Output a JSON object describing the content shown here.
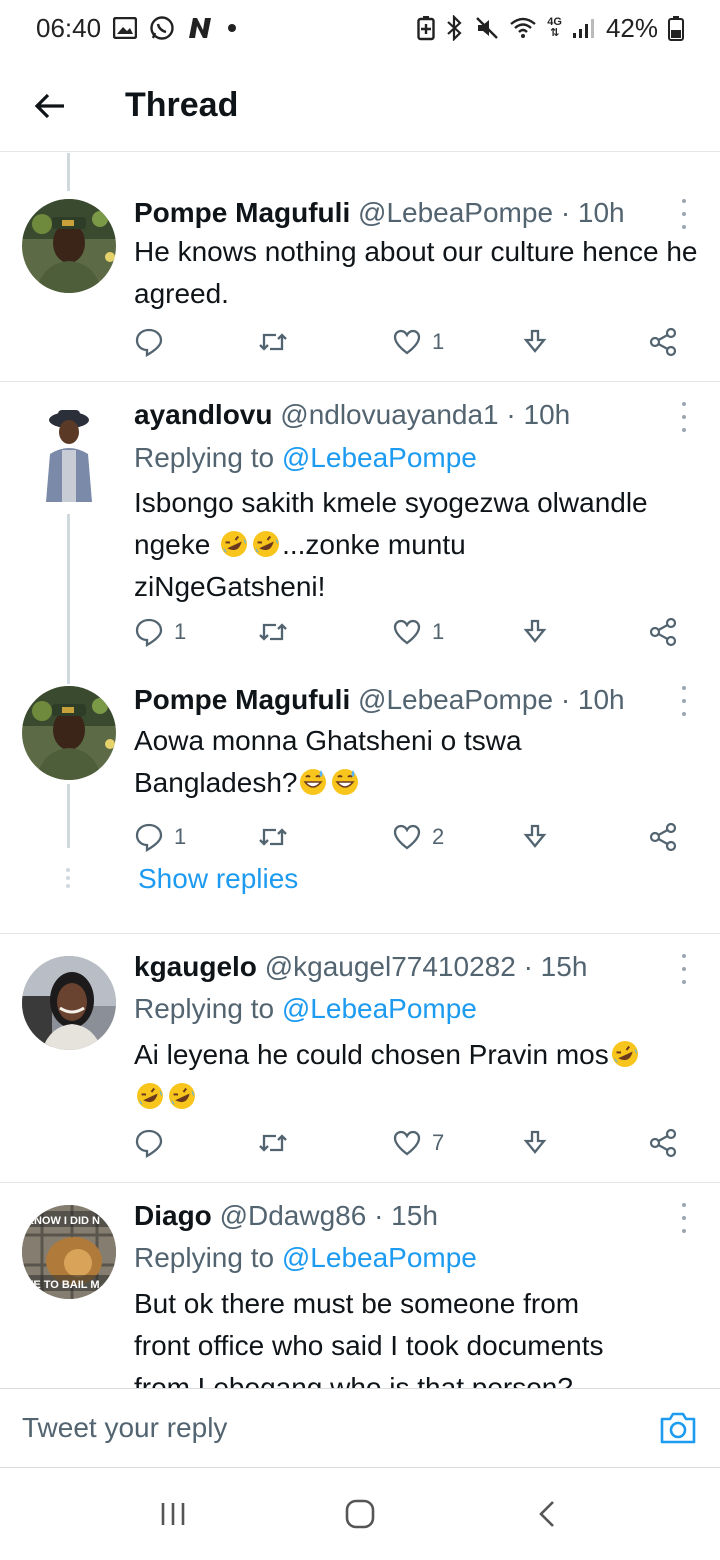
{
  "status_bar": {
    "time": "06:40",
    "network": "4G",
    "battery": "42%"
  },
  "header": {
    "title": "Thread"
  },
  "tweets": [
    {
      "name": "Pompe Magufuli",
      "handle": "@LebeaPompe",
      "time": "· 10h",
      "replying_label": "",
      "replying_handle": "",
      "text": "He knows nothing about our culture hence he agreed.",
      "replies": "",
      "retweets": "",
      "likes": "1"
    },
    {
      "name": "ayandlovu",
      "handle": "@ndlovuayanda1",
      "time": "· 10h",
      "replying_label": "Replying to",
      "replying_handle": "@LebeaPompe",
      "text_line1": "Isbongo sakith kmele syogezwa olwandle",
      "text_line2a": "ngeke",
      "text_line2b": "...zonke muntu",
      "text_line3": "ziNgeGatsheni!",
      "replies": "1",
      "retweets": "",
      "likes": "1"
    },
    {
      "name": "Pompe Magufuli",
      "handle": "@LebeaPompe",
      "time": "· 10h",
      "text_line1": "Aowa  monna Ghatsheni o tswa",
      "text_line2": "Bangladesh?",
      "replies": "1",
      "retweets": "",
      "likes": "2",
      "show_replies": "Show replies"
    },
    {
      "name": "kgaugelo",
      "handle": "@kgaugel77410282",
      "time": "· 15h",
      "replying_label": "Replying to",
      "replying_handle": "@LebeaPompe",
      "text_line1": "Ai leyena he could chosen Pravin mos",
      "replies": "",
      "retweets": "",
      "likes": "7"
    },
    {
      "name": "Diago",
      "handle": "@Ddawg86",
      "time": "· 15h",
      "replying_label": "Replying to",
      "replying_handle": "@LebeaPompe",
      "text_line1": "But ok there must be someone from",
      "text_line2": "front office who said I took documents",
      "text_line3": "from Lebogang who is that person?",
      "avatar_text_top": "KNOW I DID N",
      "avatar_text_bottom": "VE TO BAIL M"
    }
  ],
  "compose": {
    "placeholder": "Tweet your reply"
  },
  "icons": {
    "accent": "#1d9bf0",
    "muted": "#536471"
  }
}
